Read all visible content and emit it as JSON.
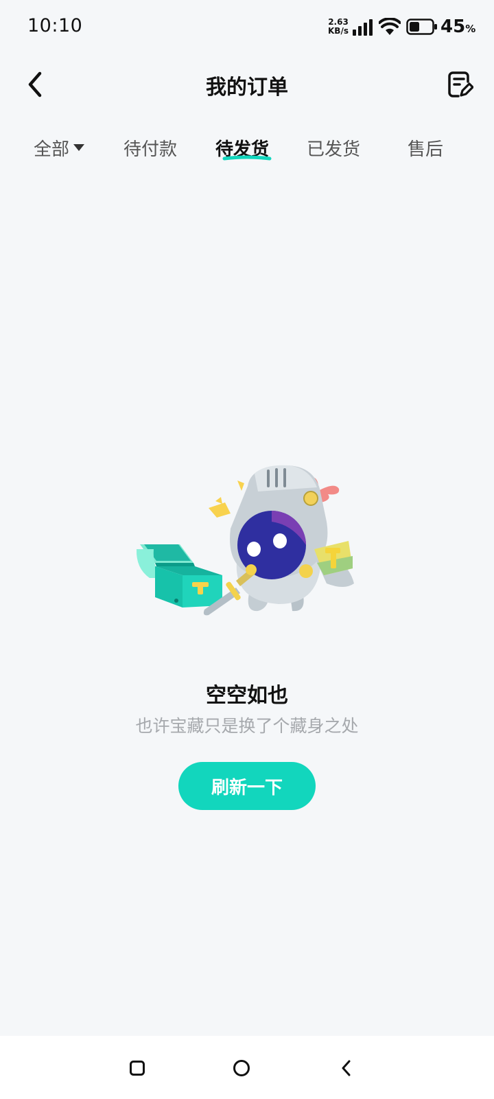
{
  "status_bar": {
    "time": "10:10",
    "net_speed_value": "2.63",
    "net_speed_unit": "KB/s",
    "battery_percent": "45",
    "battery_unit": "%",
    "battery_level": 0.45
  },
  "header": {
    "title": "我的订单",
    "back_icon": "chevron-left-icon",
    "right_icon": "edit-note-icon"
  },
  "tabs": [
    {
      "label": "全部",
      "has_dropdown": true,
      "active": false
    },
    {
      "label": "待付款",
      "active": false
    },
    {
      "label": "待发货",
      "active": true
    },
    {
      "label": "已发货",
      "active": false
    },
    {
      "label": "售后",
      "active": false
    }
  ],
  "empty_state": {
    "title": "空空如也",
    "subtitle": "也许宝藏只是换了个藏身之处",
    "button_label": "刷新一下",
    "illustration": "knight-mascot-with-treasure-chest"
  },
  "nav_bar": {
    "items": [
      "recents-square-icon",
      "home-circle-icon",
      "back-chevron-icon"
    ]
  },
  "colors": {
    "accent": "#12d6bd",
    "background": "#f5f7f9",
    "subtitle": "#a6a9ad"
  }
}
